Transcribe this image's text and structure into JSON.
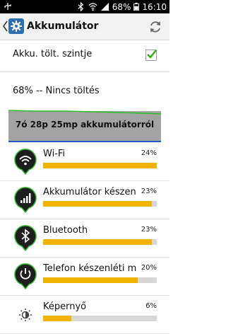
{
  "status_bar": {
    "battery_percent": "68%",
    "time": "16:10"
  },
  "app_bar": {
    "title": "Akkumulátor"
  },
  "settings": {
    "show_level_label": "Akku. tölt. szintje",
    "show_level_checked": true,
    "charge_status": "68% -- Nincs töltés"
  },
  "graph": {
    "label": "7ó 28p 25mp akkumulátorról"
  },
  "usage_items": [
    {
      "name": "Wi-Fi",
      "percent": "24%",
      "value": 0.24,
      "icon": "wifi-icon"
    },
    {
      "name": "Akkumulátor készenlét",
      "percent": "23%",
      "value": 0.23,
      "icon": "signal-icon"
    },
    {
      "name": "Bluetooth",
      "percent": "23%",
      "value": 0.23,
      "icon": "bluetooth-icon"
    },
    {
      "name": "Telefon készenléti mód",
      "percent": "20%",
      "value": 0.2,
      "icon": "power-icon"
    },
    {
      "name": "Képernyő",
      "percent": "6%",
      "value": 0.06,
      "icon": "brightness-icon"
    }
  ],
  "colors": {
    "bar_fill": "#f0b400",
    "bar_track": "#d7d7d7",
    "graph_line": "#2bbf2b",
    "graph_axis": "#2a5cc6"
  }
}
